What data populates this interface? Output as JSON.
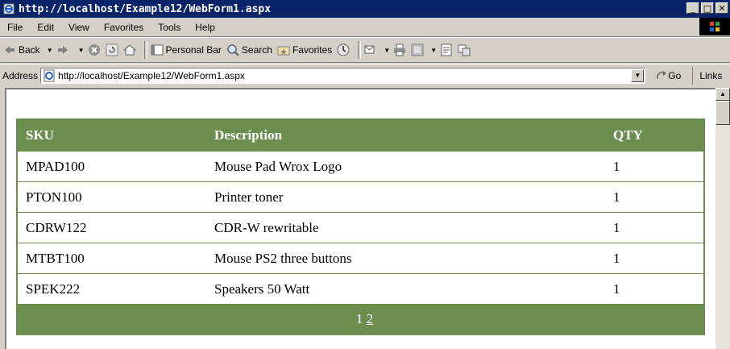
{
  "window": {
    "title": "http://localhost/Example12/WebForm1.aspx",
    "minimize": "_",
    "maximize": "□",
    "close": "✕"
  },
  "menu": {
    "items": [
      "File",
      "Edit",
      "View",
      "Favorites",
      "Tools",
      "Help"
    ]
  },
  "toolbar": {
    "back_label": "Back",
    "personal_bar_label": "Personal Bar",
    "search_label": "Search",
    "favorites_label": "Favorites"
  },
  "address": {
    "label": "Address",
    "url": "http://localhost/Example12/WebForm1.aspx",
    "go_label": "Go",
    "links_label": "Links »"
  },
  "grid": {
    "headers": {
      "sku": "SKU",
      "description": "Description",
      "qty": "QTY"
    },
    "rows": [
      {
        "sku": "MPAD100",
        "description": "Mouse Pad Wrox Logo",
        "qty": "1"
      },
      {
        "sku": "PTON100",
        "description": "Printer toner",
        "qty": "1"
      },
      {
        "sku": "CDRW122",
        "description": "CDR-W rewritable",
        "qty": "1"
      },
      {
        "sku": "MTBT100",
        "description": "Mouse PS2 three buttons",
        "qty": "1"
      },
      {
        "sku": "SPEK222",
        "description": "Speakers 50 Watt",
        "qty": "1"
      }
    ],
    "pager": {
      "current": "1",
      "next": "2"
    }
  },
  "colors": {
    "header_green": "#6b8e4e",
    "titlebar_blue": "#0a246a",
    "chrome_gray": "#d4d0c8"
  }
}
